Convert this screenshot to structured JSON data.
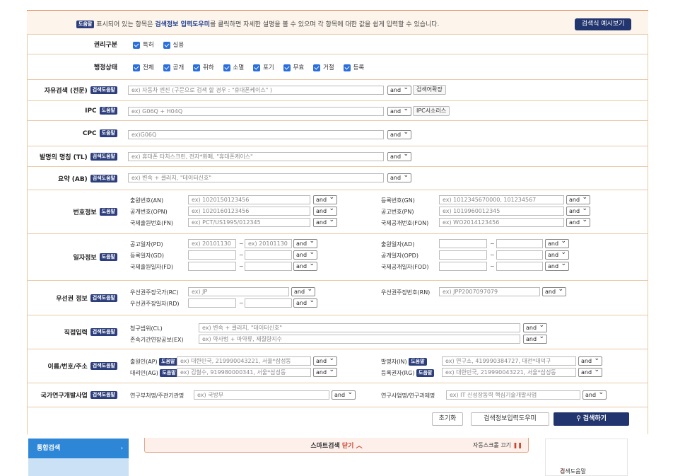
{
  "notice": {
    "badge": "도움말",
    "pre": "표시되어 있는 항목은",
    "highlight": "검색정보 입력도우미",
    "post": "를 클릭하면 자세한 설명을 볼 수 있으며 각 항목에 대한 값을 쉽게 입력할 수 있습니다.",
    "example_button": "검색식 예시보기"
  },
  "badges": {
    "help": "도움말",
    "assist": "검색도움말"
  },
  "rights": {
    "label": "권리구분",
    "options": [
      "특허",
      "실용"
    ]
  },
  "status": {
    "label": "행정상태",
    "options": [
      "전체",
      "공개",
      "취하",
      "소멸",
      "포기",
      "무효",
      "거절",
      "등록"
    ]
  },
  "free_search": {
    "label": "자유검색 (전문)",
    "placeholder": "ex) 자동차 엔진 (구문으로 검색 할 경우 : \"휴대폰케이스\" )",
    "op": "and",
    "extra": "검색어확장"
  },
  "ipc": {
    "label": "IPC",
    "placeholder": "ex) G06Q + H04Q",
    "op": "and",
    "extra": "IPC시소러스"
  },
  "cpc": {
    "label": "CPC",
    "placeholder": "ex)G06Q",
    "op": "and"
  },
  "title_field": {
    "label": "발명의 명칭 (TL)",
    "placeholder": "ex) 휴대폰 타치스크린, 전자*화폐, \"휴대폰케이스\"",
    "op": "and"
  },
  "abstract": {
    "label": "요약 (AB)",
    "placeholder": "ex) 변속 + 클러치, \"데이터신호\"",
    "op": "and"
  },
  "numbers": {
    "label": "번호정보",
    "left": [
      {
        "name": "출원번호(AN)",
        "placeholder": "ex) 1020150123456",
        "op": "and"
      },
      {
        "name": "공개번호(OPN)",
        "placeholder": "ex) 1020160123456",
        "op": "and"
      },
      {
        "name": "국제출원번호(FN)",
        "placeholder": "ex) PCT/US1995/012345",
        "op": "and"
      }
    ],
    "right": [
      {
        "name": "등록번호(GN)",
        "placeholder": "ex) 1012345670000, 101234567",
        "op": "and"
      },
      {
        "name": "공고번호(PN)",
        "placeholder": "ex) 1019960012345",
        "op": "and"
      },
      {
        "name": "국제공개번호(FON)",
        "placeholder": "ex) WO2014123456",
        "op": "and"
      }
    ]
  },
  "dates": {
    "label": "일자정보",
    "left": [
      {
        "name": "공고일자(PD)",
        "from": "ex) 20101130",
        "to": "ex) 20101130",
        "op": "and"
      },
      {
        "name": "등록일자(GD)",
        "from": "",
        "to": "",
        "op": "and"
      },
      {
        "name": "국제출원일자(FD)",
        "from": "",
        "to": "",
        "op": "and"
      }
    ],
    "right": [
      {
        "name": "출원일자(AD)",
        "op": "and"
      },
      {
        "name": "공개일자(OPD)",
        "op": "and"
      },
      {
        "name": "국제공개일자(FOD)",
        "op": "and"
      }
    ]
  },
  "priority": {
    "label": "우선권 정보",
    "country": {
      "name": "우선권주장국가(RC)",
      "placeholder": "ex) JP",
      "op": "and"
    },
    "number": {
      "name": "우선권주장번호(RN)",
      "placeholder": "ex) JPP2007097079",
      "op": "and"
    },
    "date": {
      "name": "우선권주장일자(RD)",
      "op": "and"
    }
  },
  "direct": {
    "label": "직접입력",
    "claims": {
      "name": "청구범위(CL)",
      "placeholder": "ex) 변속 + 클러치, \"데이터신호\"",
      "op": "and"
    },
    "extension": {
      "name": "존속기간연장공보(EX)",
      "placeholder": "ex) 약사법 + 마약류, 제질량지수",
      "op": "and"
    }
  },
  "names": {
    "label": "이름/번호/주소",
    "applicant": {
      "name": "출원인(AP)",
      "placeholder": "ex) 대한민국, 219990043221, 서울*삼성동",
      "op": "and"
    },
    "agent": {
      "name": "대리인(AG)",
      "placeholder": "ex) 김철수, 919980000341, 서울*삼성동",
      "op": "and"
    },
    "inventor": {
      "name": "발명자(IN)",
      "placeholder": "ex) 연구소, 419990384727, 대전*대덕구",
      "op": "and"
    },
    "owner": {
      "name": "등록권자(RG)",
      "placeholder": "ex) 대한민국, 219990043221, 서울*삼성동",
      "op": "and"
    }
  },
  "national": {
    "label": "국가연구개발사업",
    "ministry": {
      "name": "연구부처명/주관기관명",
      "placeholder": "ex) 국방부",
      "op": "and"
    },
    "project": {
      "name": "연구사업명/연구과제명",
      "placeholder": "ex) IT 신성장동력 핵심기술개발사업",
      "op": "and"
    }
  },
  "buttons": {
    "reset": "초기화",
    "helper": "검색정보입력도우미",
    "search": "검색하기"
  },
  "bottom": {
    "left_tab": "통합검색",
    "smart_prefix": "스마트검색",
    "smart_close": "닫기",
    "auto_scroll": "자동스크롤 끄기",
    "help": "검색도움말"
  }
}
